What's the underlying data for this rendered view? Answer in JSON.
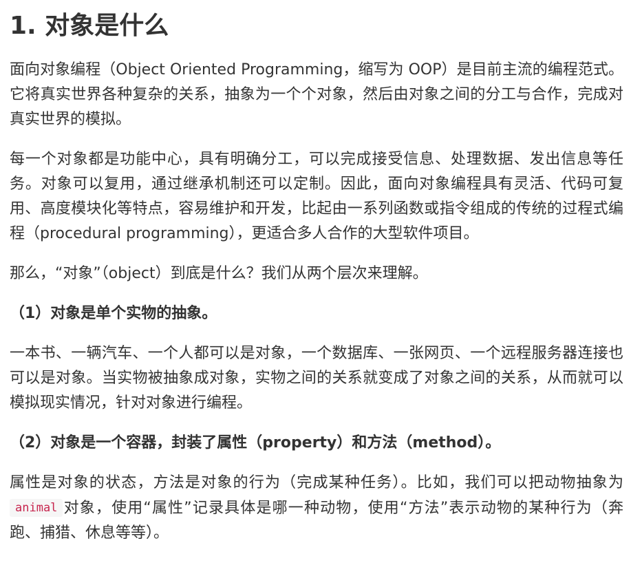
{
  "heading": "1. 对象是什么",
  "para1": "面向对象编程（Object Oriented Programming，缩写为 OOP）是目前主流的编程范式。它将真实世界各种复杂的关系，抽象为一个个对象，然后由对象之间的分工与合作，完成对真实世界的模拟。",
  "para2": "每一个对象都是功能中心，具有明确分工，可以完成接受信息、处理数据、发出信息等任务。对象可以复用，通过继承机制还可以定制。因此，面向对象编程具有灵活、代码可复用、高度模块化等特点，容易维护和开发，比起由一系列函数或指令组成的传统的过程式编程（procedural programming），更适合多人合作的大型软件项目。",
  "para3": "那么，“对象”（object）到底是什么？我们从两个层次来理解。",
  "sub1": "（1）对象是单个实物的抽象。",
  "para4": "一本书、一辆汽车、一个人都可以是对象，一个数据库、一张网页、一个远程服务器连接也可以是对象。当实物被抽象成对象，实物之间的关系就变成了对象之间的关系，从而就可以模拟现实情况，针对对象进行编程。",
  "sub2": "（2）对象是一个容器，封装了属性（property）和方法（method）。",
  "para5": {
    "before": "属性是对象的状态，方法是对象的行为（完成某种任务）。比如，我们可以把动物抽象为",
    "code": "animal",
    "after": "对象，使用“属性”记录具体是哪一种动物，使用“方法”表示动物的某种行为（奔跑、捕猎、休息等等）。"
  }
}
